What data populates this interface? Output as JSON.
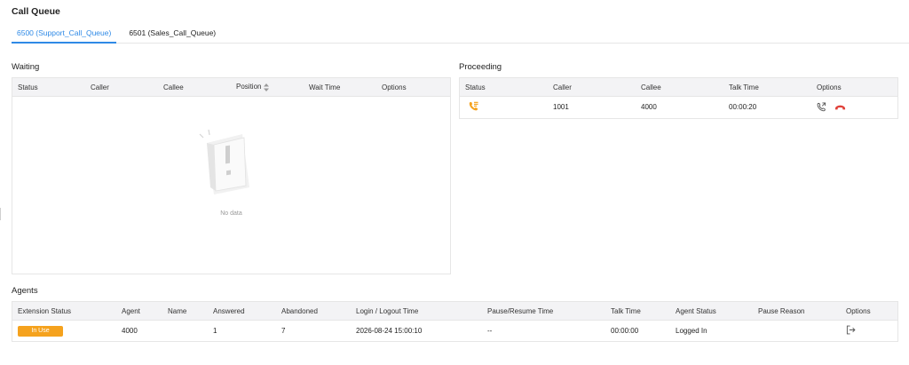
{
  "page": {
    "title": "Call Queue"
  },
  "tabs": [
    {
      "label": "6500 (Support_Call_Queue)",
      "active": true
    },
    {
      "label": "6501 (Sales_Call_Queue)",
      "active": false
    }
  ],
  "waiting": {
    "title": "Waiting",
    "columns": [
      "Status",
      "Caller",
      "Callee",
      "Position",
      "Wait Time",
      "Options"
    ],
    "empty_text": "No data"
  },
  "proceeding": {
    "title": "Proceeding",
    "columns": [
      "Status",
      "Caller",
      "Callee",
      "Talk Time",
      "Options"
    ],
    "rows": [
      {
        "status_icon": "incoming-call-icon",
        "caller": "1001",
        "callee": "4000",
        "talk_time": "00:00:20"
      }
    ]
  },
  "agents": {
    "title": "Agents",
    "columns": [
      "Extension Status",
      "Agent",
      "Name",
      "Answered",
      "Abandoned",
      "Login / Logout Time",
      "Pause/Resume Time",
      "Talk Time",
      "Agent Status",
      "Pause Reason",
      "Options"
    ],
    "rows": [
      {
        "extension_status": "In Use",
        "agent": "4000",
        "name": "",
        "answered": "1",
        "abandoned": "7",
        "login_logout_time": "2026-08-24 15:00:10",
        "pause_resume_time": "--",
        "talk_time": "00:00:00",
        "agent_status": "Logged In",
        "pause_reason": ""
      }
    ]
  },
  "colors": {
    "accent": "#2f8ae6",
    "in_use": "#f5a21d",
    "hangup": "#e0413a",
    "call_icon": "#f5a21d"
  }
}
